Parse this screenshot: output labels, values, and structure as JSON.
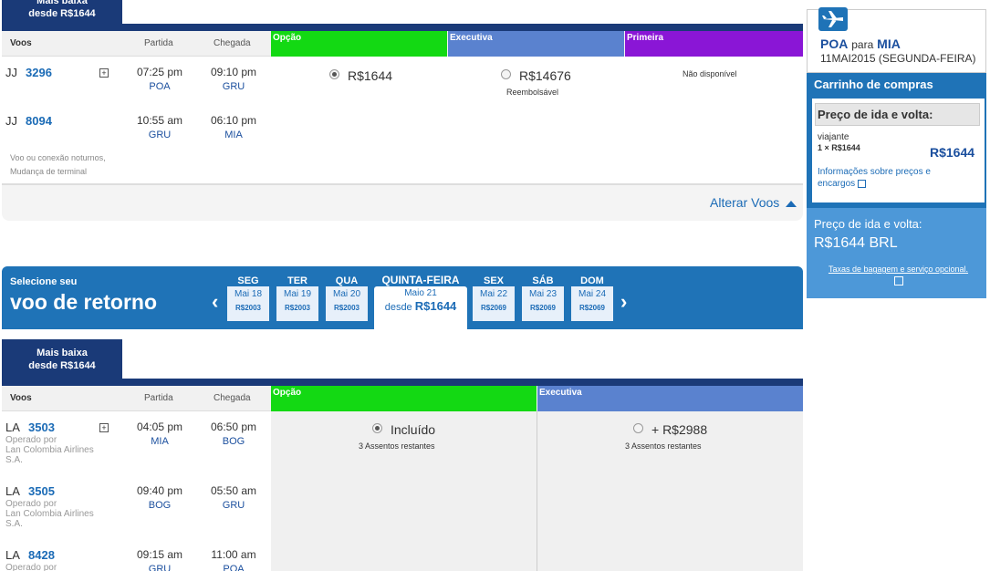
{
  "outbound": {
    "tab_line1": "Mais baixa",
    "tab_line2": "desde R$1644",
    "headers": {
      "flights": "Voos",
      "departure": "Partida",
      "arrival": "Chegada"
    },
    "fare_headers": [
      "Opção",
      "Executiva",
      "Primeira"
    ],
    "flights": [
      {
        "airline": "JJ",
        "number": "3296",
        "dep_time": "07:25 pm",
        "dep_code": "POA",
        "arr_time": "09:10 pm",
        "arr_code": "GRU"
      },
      {
        "airline": "JJ",
        "number": "8094",
        "dep_time": "10:55 am",
        "dep_code": "GRU",
        "arr_time": "06:10 pm",
        "arr_code": "MIA"
      }
    ],
    "fare_option": "R$1644",
    "fare_exec": "R$14676",
    "fare_exec_note": "Reembolsável",
    "fare_first": "Não disponível",
    "note_line1": "Voo ou conexão noturnos,",
    "note_line2": "Mudança de terminal",
    "change_link": "Alterar Voos"
  },
  "return_banner": {
    "subtitle": "Selecione seu",
    "title": "voo de retorno",
    "prev": "‹",
    "next": "›",
    "days": [
      {
        "dow": "SEG",
        "date": "Mai 18",
        "price": "R$2003"
      },
      {
        "dow": "TER",
        "date": "Mai 19",
        "price": "R$2003"
      },
      {
        "dow": "QUA",
        "date": "Mai 20",
        "price": "R$2003"
      },
      {
        "dow": "SEX",
        "date": "Mai 22",
        "price": "R$2069"
      },
      {
        "dow": "SÁB",
        "date": "Mai 23",
        "price": "R$2069"
      },
      {
        "dow": "DOM",
        "date": "Mai 24",
        "price": "R$2069"
      }
    ],
    "selected": {
      "dow": "QUINTA-FEIRA",
      "date": "Maio 21",
      "from": "desde",
      "price": "R$1644"
    }
  },
  "inbound": {
    "tab_line1": "Mais baixa",
    "tab_line2": "desde R$1644",
    "headers": {
      "flights": "Voos",
      "departure": "Partida",
      "arrival": "Chegada"
    },
    "fare_headers": [
      "Opção",
      "Executiva"
    ],
    "flights": [
      {
        "airline": "LA",
        "number": "3503",
        "op1": "Operado por",
        "op2": "Lan Colombia Airlines",
        "op3": "S.A.",
        "dep_time": "04:05 pm",
        "dep_code": "MIA",
        "arr_time": "06:50 pm",
        "arr_code": "BOG"
      },
      {
        "airline": "LA",
        "number": "3505",
        "op1": "Operado por",
        "op2": "Lan Colombia Airlines",
        "op3": "S.A.",
        "dep_time": "09:40 pm",
        "dep_code": "BOG",
        "arr_time": "05:50 am",
        "arr_code": "GRU"
      },
      {
        "airline": "LA",
        "number": "8428",
        "op1": "Operado por",
        "dep_time": "09:15 am",
        "dep_code": "GRU",
        "arr_time": "11:00 am",
        "arr_code": "POA"
      }
    ],
    "fare_option": "Incluído",
    "fare_option_seats": "3 Assentos restantes",
    "fare_exec": "+ R$2988",
    "fare_exec_seats": "3 Assentos restantes"
  },
  "sidebar": {
    "from": "POA",
    "para": "para",
    "to": "MIA",
    "date": "11MAI2015 (SEGUNDA-FEIRA)",
    "cart_title": "Carrinho de compras",
    "roundtrip_label": "Preço de ida e volta:",
    "traveler": "viajante",
    "traveler_qty": "1 × R$1644",
    "traveler_total": "R$1644",
    "info_link_1": "Informações sobre preços e",
    "info_link_2": "encargos",
    "total_label": "Preço de ida e volta:",
    "total_value": "R$1644 BRL",
    "baggage_link": "Taxas de bagagem e serviço opcional."
  },
  "colors": {
    "navy": "#1a3a78",
    "blue": "#1f73b7",
    "link": "#1b6bb6",
    "green": "#13d913",
    "exec": "#5a82cf",
    "first": "#8a16d6"
  }
}
